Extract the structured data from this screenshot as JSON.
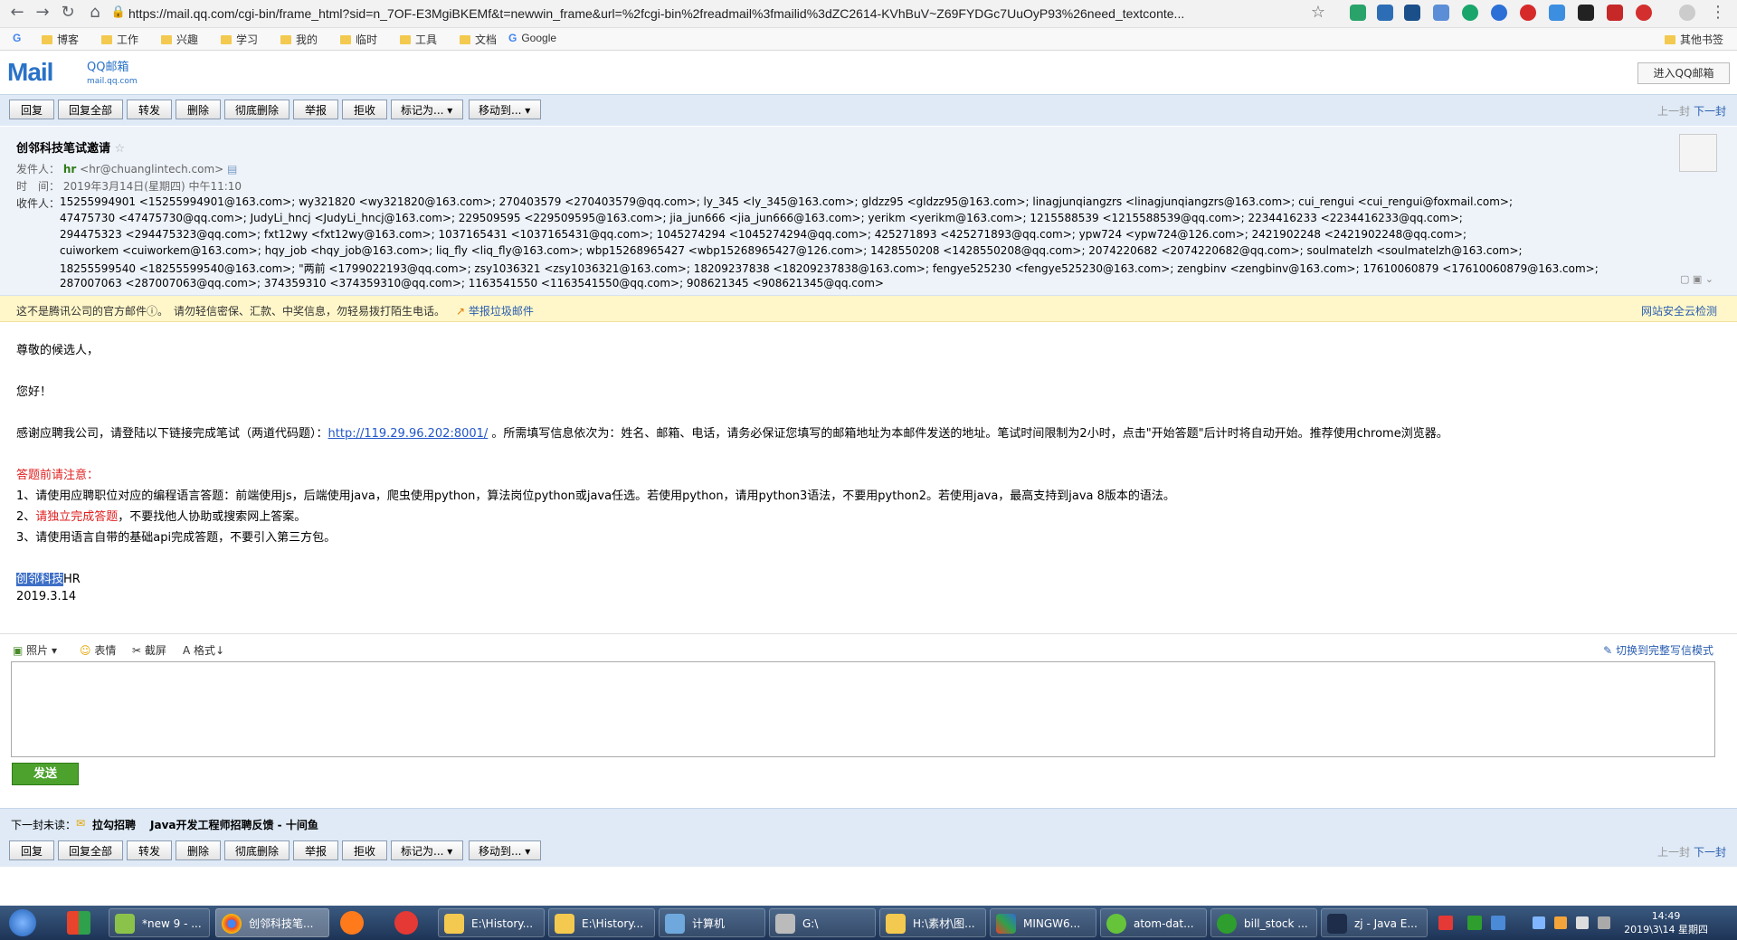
{
  "browser": {
    "url": "https://mail.qq.com/cgi-bin/frame_html?sid=n_7OF-E3MgiBKEMf&t=newwin_frame&url=%2fcgi-bin%2freadmail%3fmailid%3dZC2614-KVhBuV~Z69FYDGc7UuOyP93%26need_textconte...",
    "bookmarks": [
      "博客",
      "工作",
      "兴趣",
      "学习",
      "我的",
      "临时",
      "工具",
      "文档",
      "Google"
    ],
    "other_bookmarks": "其他书签"
  },
  "mail_header": {
    "logo": "Mail",
    "logo_sub": "QQ邮箱",
    "logo_sub2": "mail.qq.com",
    "enter_button": "进入QQ邮箱"
  },
  "toolbar": {
    "reply": "回复",
    "reply_all": "回复全部",
    "forward": "转发",
    "delete": "删除",
    "delete_permanent": "彻底删除",
    "report": "举报",
    "reject": "拒收",
    "mark_as": "标记为...",
    "move_to": "移动到...",
    "prev": "上一封",
    "next": "下一封"
  },
  "email": {
    "subject": "创邻科技笔试邀请",
    "sender_label": "发件人：",
    "sender_name": "hr",
    "sender_email": "<hr@chuanglintech.com>",
    "time_label": "时　间：",
    "time": "2019年3月14日(星期四) 中午11:10",
    "recipients_label": "收件人：",
    "recipients_lines": [
      "15255994901 <15255994901@163.com>; wy321820 <wy321820@163.com>; 270403579 <270403579@qq.com>; ly_345 <ly_345@163.com>; gldzz95 <gldzz95@163.com>; linagjunqiangzrs <linagjunqiangzrs@163.com>; cui_rengui <cui_rengui@foxmail.com>;",
      "47475730 <47475730@qq.com>; JudyLi_hncj <JudyLi_hncj@163.com>; 229509595 <229509595@163.com>; jia_jun666 <jia_jun666@163.com>; yerikm <yerikm@163.com>; 1215588539 <1215588539@qq.com>; 2234416233 <2234416233@qq.com>;",
      "294475323 <294475323@qq.com>; fxt12wy <fxt12wy@163.com>; 1037165431 <1037165431@qq.com>; 1045274294 <1045274294@qq.com>; 425271893 <425271893@qq.com>; ypw724 <ypw724@126.com>; 2421902248 <2421902248@qq.com>;",
      "cuiworkem <cuiworkem@163.com>; hqy_job <hqy_job@163.com>; liq_fly <liq_fly@163.com>; wbp15268965427 <wbp15268965427@126.com>; 1428550208 <1428550208@qq.com>; 2074220682 <2074220682@qq.com>; soulmatelzh <soulmatelzh@163.com>;",
      "18255599540 <18255599540@163.com>; \"两前 <1799022193@qq.com>; zsy1036321 <zsy1036321@163.com>; 18209237838 <18209237838@163.com>; fengye525230 <fengye525230@163.com>; zengbinv <zengbinv@163.com>; 17610060879 <17610060879@163.com>;",
      "287007063 <287007063@qq.com>; 374359310 <374359310@qq.com>; 1163541550 <1163541550@qq.com>; 908621345 <908621345@qq.com>"
    ]
  },
  "warning": {
    "text": "这不是腾讯公司的官方邮件ⓘ。　请勿轻信密保、汇款、中奖信息，勿轻易拨打陌生电话。",
    "report_link": "举报垃圾邮件",
    "security": "网站安全云检测"
  },
  "body": {
    "greeting": "尊敬的候选人，",
    "hello": "您好！",
    "para_pre": "感谢应聘我公司，请登陆以下链接完成笔试（两道代码题）：",
    "link": "http://119.29.96.202:8001/",
    "para_post": " 。所需填写信息依次为：姓名、邮箱、电话，请务必保证您填写的邮箱地址为本邮件发送的地址。笔试时间限制为2小时，点击\"开始答题\"后计时将自动开始。推荐使用chrome浏览器。",
    "notice_title": "答题前请注意：",
    "rule1": "1、请使用应聘职位对应的编程语言答题：前端使用js，后端使用java，爬虫使用python，算法岗位python或java任选。若使用python，请用python3语法，不要用python2。若使用java，最高支持到java 8版本的语法。",
    "rule2_pre": "2、",
    "rule2_red": "请独立完成答题",
    "rule2_post": "，不要找他人协助或搜索网上答案。",
    "rule3": "3、请使用语言自带的基础api完成答题，不要引入第三方包。",
    "sign_company": "创邻科技",
    "sign_hr": "HR",
    "date": "2019.3.14"
  },
  "reply": {
    "photo": "照片",
    "emoji": "表情",
    "screenshot": "截屏",
    "format": "格式",
    "switch_full": "切换到完整写信模式",
    "send": "发送"
  },
  "next_unread": {
    "label": "下一封未读：",
    "sender": "拉勾招聘",
    "subject": "Java开发工程师招聘反馈 - 十间鱼"
  },
  "taskbar": {
    "tasks": [
      "*new 9 - ...",
      "创邻科技笔...",
      "E:\\History...",
      "E:\\History...",
      "计算机",
      "G:\\",
      "H:\\素材\\图...",
      "MINGW6...",
      "atom-dat...",
      "bill_stock ...",
      "zj - Java E..."
    ],
    "time": "14:49",
    "date": "2019\\3\\14 星期四"
  }
}
